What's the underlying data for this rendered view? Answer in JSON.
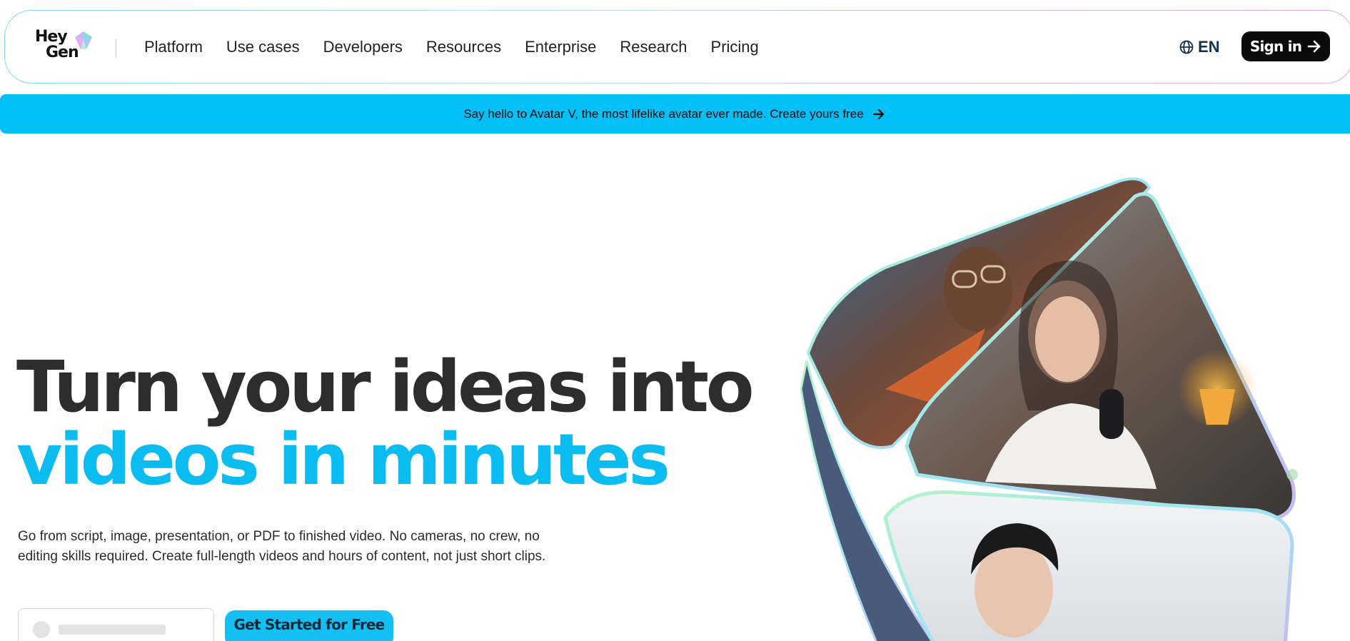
{
  "brand": {
    "logo_line1": "Hey",
    "logo_line2": "Gen"
  },
  "nav": {
    "items": [
      {
        "label": "Platform"
      },
      {
        "label": "Use cases"
      },
      {
        "label": "Developers"
      },
      {
        "label": "Resources"
      },
      {
        "label": "Enterprise"
      },
      {
        "label": "Research"
      },
      {
        "label": "Pricing"
      }
    ],
    "language": "EN",
    "signin_label": "Sign in"
  },
  "banner": {
    "text": "Say hello to Avatar V, the most lifelike avatar ever made. Create yours free"
  },
  "hero": {
    "headline_line1": "Turn your ideas into",
    "headline_line2": "videos in minutes",
    "subcopy": "Go from script, image, presentation, or PDF to finished video. No cameras, no crew, no editing skills required. Create full-length videos and hours of content, not just short clips.",
    "cta_label": "Get Started for Free"
  },
  "colors": {
    "accent": "#00c0f7",
    "headline_dark": "#2d2d2d",
    "headline_accent": "#0bbcf0",
    "signin_bg": "#0b0b0b"
  },
  "icons": {
    "globe": "globe-icon",
    "arrow": "arrow-right-icon",
    "logo_gem": "logo-gem-icon"
  }
}
